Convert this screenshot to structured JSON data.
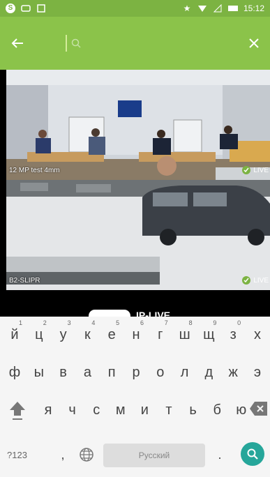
{
  "status_bar": {
    "time": "15:12"
  },
  "search": {
    "placeholder": ""
  },
  "cameras": [
    {
      "label": "12 MP test 4mm",
      "live_label": "LIVE"
    },
    {
      "label": "B2-SLIPR",
      "live_label": "LIVE"
    }
  ],
  "promo": {
    "text": "IP-LIVE"
  },
  "keyboard": {
    "row1": [
      {
        "char": "й",
        "hint": "1"
      },
      {
        "char": "ц",
        "hint": "2"
      },
      {
        "char": "у",
        "hint": "3"
      },
      {
        "char": "к",
        "hint": "4"
      },
      {
        "char": "е",
        "hint": "5"
      },
      {
        "char": "н",
        "hint": "6"
      },
      {
        "char": "г",
        "hint": "7"
      },
      {
        "char": "ш",
        "hint": "8"
      },
      {
        "char": "щ",
        "hint": "9"
      },
      {
        "char": "з",
        "hint": "0"
      },
      {
        "char": "х",
        "hint": ""
      }
    ],
    "row2": [
      "ф",
      "ы",
      "в",
      "а",
      "п",
      "р",
      "о",
      "л",
      "д",
      "ж",
      "э"
    ],
    "row3": [
      "я",
      "ч",
      "с",
      "м",
      "и",
      "т",
      "ь",
      "б",
      "ю"
    ],
    "sym_label": "?123",
    "comma": ",",
    "space_label": "Русский",
    "period": "."
  },
  "colors": {
    "toolbar": "#8bc34a",
    "status_bar": "#7cb342",
    "search_key": "#26a69a"
  }
}
